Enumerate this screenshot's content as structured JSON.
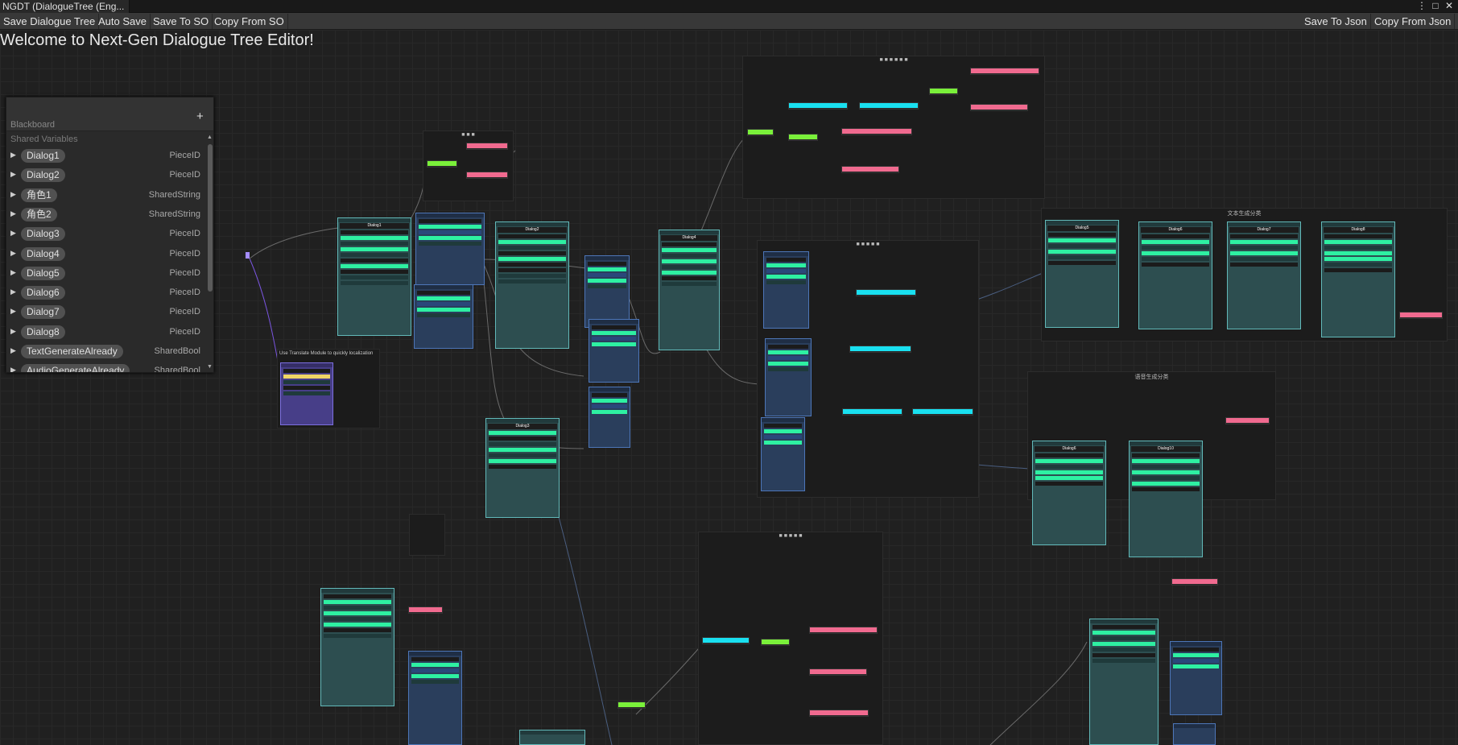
{
  "window": {
    "tab_title": "NGDT (DialogueTree  (Eng...",
    "menu_icon": "kebab-menu-icon",
    "maximize_icon": "maximize-icon",
    "close_icon": "close-icon"
  },
  "toolbar": {
    "save_dialogue_tree": "Save Dialogue Tree",
    "auto_save": "Auto Save",
    "save_to_so": "Save To SO",
    "copy_from_so": "Copy From SO",
    "save_to_json": "Save To Json",
    "copy_from_json": "Copy From Json"
  },
  "canvas": {
    "welcome": "Welcome to Next-Gen Dialogue Tree Editor!"
  },
  "blackboard": {
    "title": "Blackboard",
    "add_icon": "plus-icon",
    "section_label": "Shared Variables",
    "variables": [
      {
        "name": "Dialog1",
        "type": "PieceID"
      },
      {
        "name": "Dialog2",
        "type": "PieceID"
      },
      {
        "name": "角色1",
        "type": "SharedString"
      },
      {
        "name": "角色2",
        "type": "SharedString"
      },
      {
        "name": "Dialog3",
        "type": "PieceID"
      },
      {
        "name": "Dialog4",
        "type": "PieceID"
      },
      {
        "name": "Dialog5",
        "type": "PieceID"
      },
      {
        "name": "Dialog6",
        "type": "PieceID"
      },
      {
        "name": "Dialog7",
        "type": "PieceID"
      },
      {
        "name": "Dialog8",
        "type": "PieceID"
      },
      {
        "name": "TextGenerateAlready",
        "type": "SharedBool"
      },
      {
        "name": "AudioGenerateAlready",
        "type": "SharedBool"
      }
    ]
  },
  "nodes": {
    "dialog1": "Dialog1",
    "dialog2": "Dialog2",
    "dialog3": "Dialog3",
    "dialog4": "Dialog4",
    "dialog5": "Dialog5",
    "dialog6": "Dialog6",
    "dialog7": "Dialog7",
    "dialog8": "Dialog8",
    "dialog10": "Dialog10"
  },
  "notes": {
    "translate_hint": "Use Translate Module to quickly localization"
  },
  "groups": {
    "text_gen": "文本生成分类",
    "voice_gen": "语音生成分类"
  }
}
